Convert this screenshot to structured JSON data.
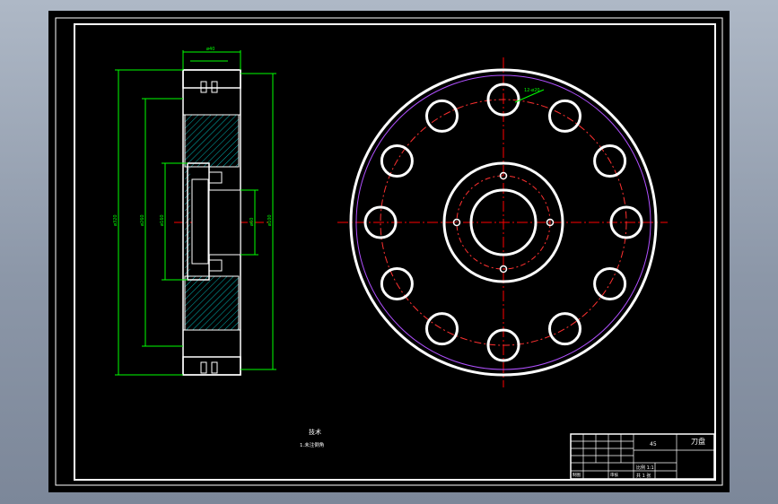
{
  "colors": {
    "background": "#000000",
    "frame": "#ffffff",
    "dimension": "#00ff00",
    "centerline": "#ff0000",
    "hatch": "#00b3b3",
    "pitch_circle": "#ff3030",
    "outer_trim": "#b050ff"
  },
  "notes": {
    "line1": "技术",
    "line2": "1.未注倒角"
  },
  "side_view_dims": {
    "top": "ø40",
    "d_outer": "ø320",
    "d_pitch": "ø260",
    "d_hub": "ø160",
    "d_right": "ø100",
    "d_bore": "ø60"
  },
  "front_view": {
    "hole_count": 12,
    "small_hole_count": 4,
    "hole_label": "12-ø20"
  },
  "title_block": {
    "name": "刀盘",
    "material": "45",
    "scale_text": "比例 1:1",
    "sheet_text": "共 1 张",
    "drawn": "制图",
    "checked": "审核"
  }
}
